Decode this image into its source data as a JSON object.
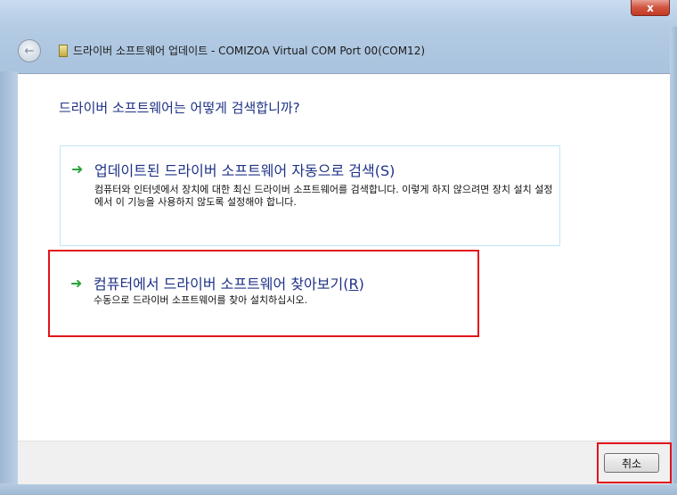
{
  "window": {
    "title": "드라이버 소프트웨어 업데이트 - COMIZOA Virtual COM Port 00(COM12)",
    "close_glyph": "x"
  },
  "content": {
    "heading": "드라이버 소프트웨어는 어떻게 검색합니까?",
    "options": [
      {
        "title": "업데이트된 드라이버 소프트웨어 자동으로 검색(S)",
        "description": "컴퓨터와 인터넷에서 장치에 대한 최신 드라이버 소프트웨어를 검색합니다. 이렇게 하지 않으려면 장치 설치 설정에서 이 기능을 사용하지 않도록 설정해야 합니다.",
        "icon": "green-arrow-icon"
      },
      {
        "title_prefix": "컴퓨터에서 드라이버 소프트웨어 찾아보기(",
        "title_hotkey": "R",
        "title_suffix": ")",
        "description": "수동으로 드라이버 소프트웨어를 찾아 설치하십시오.",
        "icon": "green-arrow-icon"
      }
    ]
  },
  "footer": {
    "cancel_label": "취소"
  },
  "colors": {
    "heading": "#1e3287",
    "arrow": "#2aa33c",
    "highlight": "#e2141a"
  }
}
